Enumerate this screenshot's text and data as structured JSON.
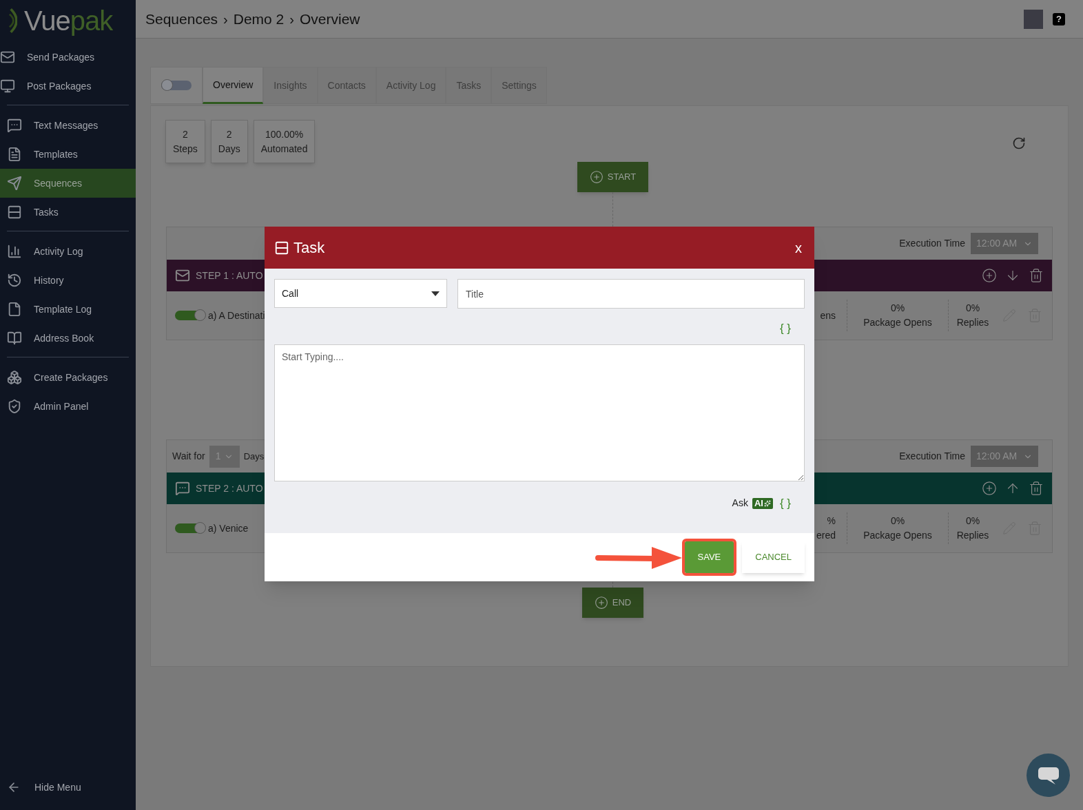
{
  "sidebar": {
    "logo": {
      "text_main": "Vue",
      "text_accent": "pak"
    },
    "sections": [
      [
        {
          "label": "Send Packages",
          "selected": false
        },
        {
          "label": "Post Packages",
          "selected": false
        }
      ],
      [
        {
          "label": "Text Messages",
          "selected": false
        },
        {
          "label": "Templates",
          "selected": false
        },
        {
          "label": "Sequences",
          "selected": true
        },
        {
          "label": "Tasks",
          "selected": false
        }
      ],
      [
        {
          "label": "Activity Log",
          "selected": false
        },
        {
          "label": "History",
          "selected": false
        },
        {
          "label": "Template Log",
          "selected": false
        },
        {
          "label": "Address Book",
          "selected": false
        }
      ],
      [
        {
          "label": "Create Packages",
          "selected": false
        },
        {
          "label": "Admin Panel",
          "selected": false
        }
      ]
    ],
    "hide_menu": "Hide Menu"
  },
  "header": {
    "breadcrumb": [
      {
        "label": "Sequences"
      },
      {
        "separator": "›",
        "label": "Demo 2"
      },
      {
        "separator": "›",
        "label": "Overview"
      }
    ],
    "help": "?"
  },
  "tabs_bar": {
    "toggle": {
      "on": false
    },
    "tabs": [
      {
        "label": "Overview",
        "selected": true
      },
      {
        "label": "Insights",
        "selected": false
      },
      {
        "label": "Contacts",
        "selected": false
      },
      {
        "label": "Activity Log",
        "selected": false
      },
      {
        "label": "Tasks",
        "selected": false
      },
      {
        "label": "Settings",
        "selected": false
      }
    ]
  },
  "summary": [
    {
      "value": "2",
      "label": "Steps"
    },
    {
      "value": "2",
      "label": "Days"
    },
    {
      "value": "100.00%",
      "label": "Automated"
    }
  ],
  "start_button": "START",
  "steps": [
    {
      "kind": "email",
      "execution_label": "Execution Time",
      "execution_time": "12:00 AM",
      "title": "STEP 1 : AUTO",
      "variant": {
        "on": true,
        "label": "a) A Destinati"
      },
      "stats": [
        {
          "label": "ens"
        },
        {
          "value": "0%",
          "label": "Package Opens"
        },
        {
          "value": "0%",
          "label": "Replies"
        }
      ]
    },
    {
      "kind": "text",
      "wait": {
        "label": "Wait for",
        "value": "1",
        "unit": "Days"
      },
      "execution_label": "Execution Time",
      "execution_time": "12:00 AM",
      "title": "STEP 2 : AUTO",
      "variant": {
        "on": true,
        "label": "a) Venice"
      },
      "stats": [
        {
          "value": "%",
          "label": "ered"
        },
        {
          "value": "0%",
          "label": "Package Opens"
        },
        {
          "value": "0%",
          "label": "Replies"
        }
      ]
    }
  ],
  "end_button": "END",
  "modal": {
    "title": "Task",
    "close": "x",
    "type_select": "Call",
    "title_field": {
      "placeholder": "Title"
    },
    "variables_top": "{ }",
    "body_field": {
      "placeholder": "Start Typing...."
    },
    "ask_label": "Ask",
    "ai_badge": "AI",
    "variables_bottom": "{ }",
    "buttons": [
      {
        "label": "SAVE",
        "kind": "primary",
        "highlighted": true
      },
      {
        "label": "CANCEL",
        "kind": "secondary",
        "highlighted": false
      }
    ]
  }
}
